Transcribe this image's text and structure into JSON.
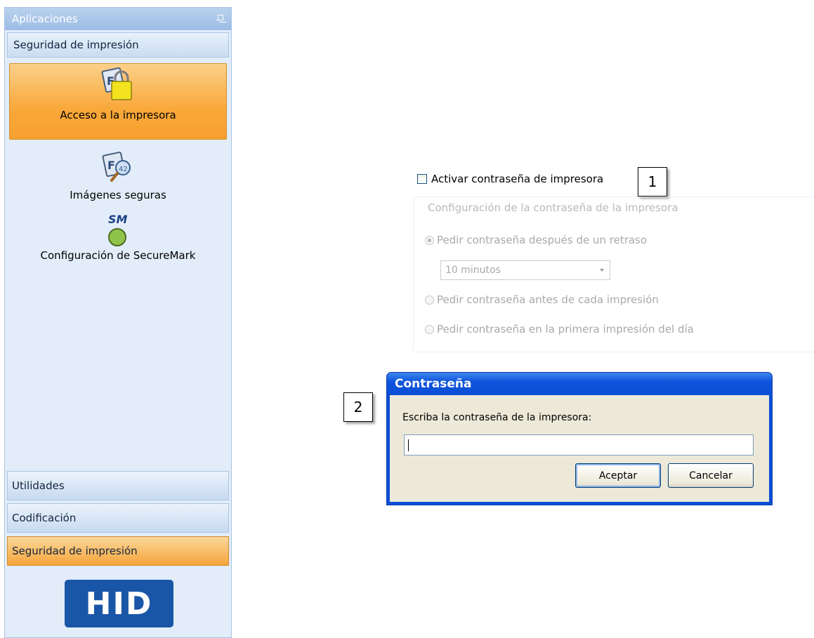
{
  "sidebar": {
    "header": "Aplicaciones",
    "group_title": "Seguridad de impresión",
    "items": [
      {
        "label": "Acceso a la impresora",
        "selected": true,
        "icon": "card-lock-icon"
      },
      {
        "label": "Imágenes seguras",
        "selected": false,
        "icon": "card-magnifier-icon"
      },
      {
        "label": "Configuración de SecureMark",
        "selected": false,
        "icon": "securemark-icon",
        "icon_text": "SM"
      }
    ],
    "footer_groups": [
      {
        "label": "Utilidades",
        "active": false
      },
      {
        "label": "Codificación",
        "active": false
      },
      {
        "label": "Seguridad de impresión",
        "active": true
      }
    ],
    "logo_text": "HID"
  },
  "settings": {
    "enable_password_label": "Activar contraseña de impresora",
    "enable_password_checked": false,
    "config_group_title": "Configuración de la contraseña de la impresora",
    "options": [
      "Pedir contraseña después de un retraso",
      "Pedir contraseña antes de cada impresión",
      "Pedir contraseña en la primera impresión del día"
    ],
    "selected_option_index": 0,
    "delay_value": "10 minutos"
  },
  "callouts": {
    "one": "1",
    "two": "2"
  },
  "dialog": {
    "title": "Contraseña",
    "prompt": "Escriba la contraseña de la impresora:",
    "input_value": "",
    "ok_label": "Aceptar",
    "cancel_label": "Cancelar"
  },
  "colors": {
    "accent_orange": "#f9a83a",
    "sidebar_bg": "#e2edf9",
    "dialog_blue": "#0a4fd6",
    "hid_blue": "#1a56a8"
  }
}
